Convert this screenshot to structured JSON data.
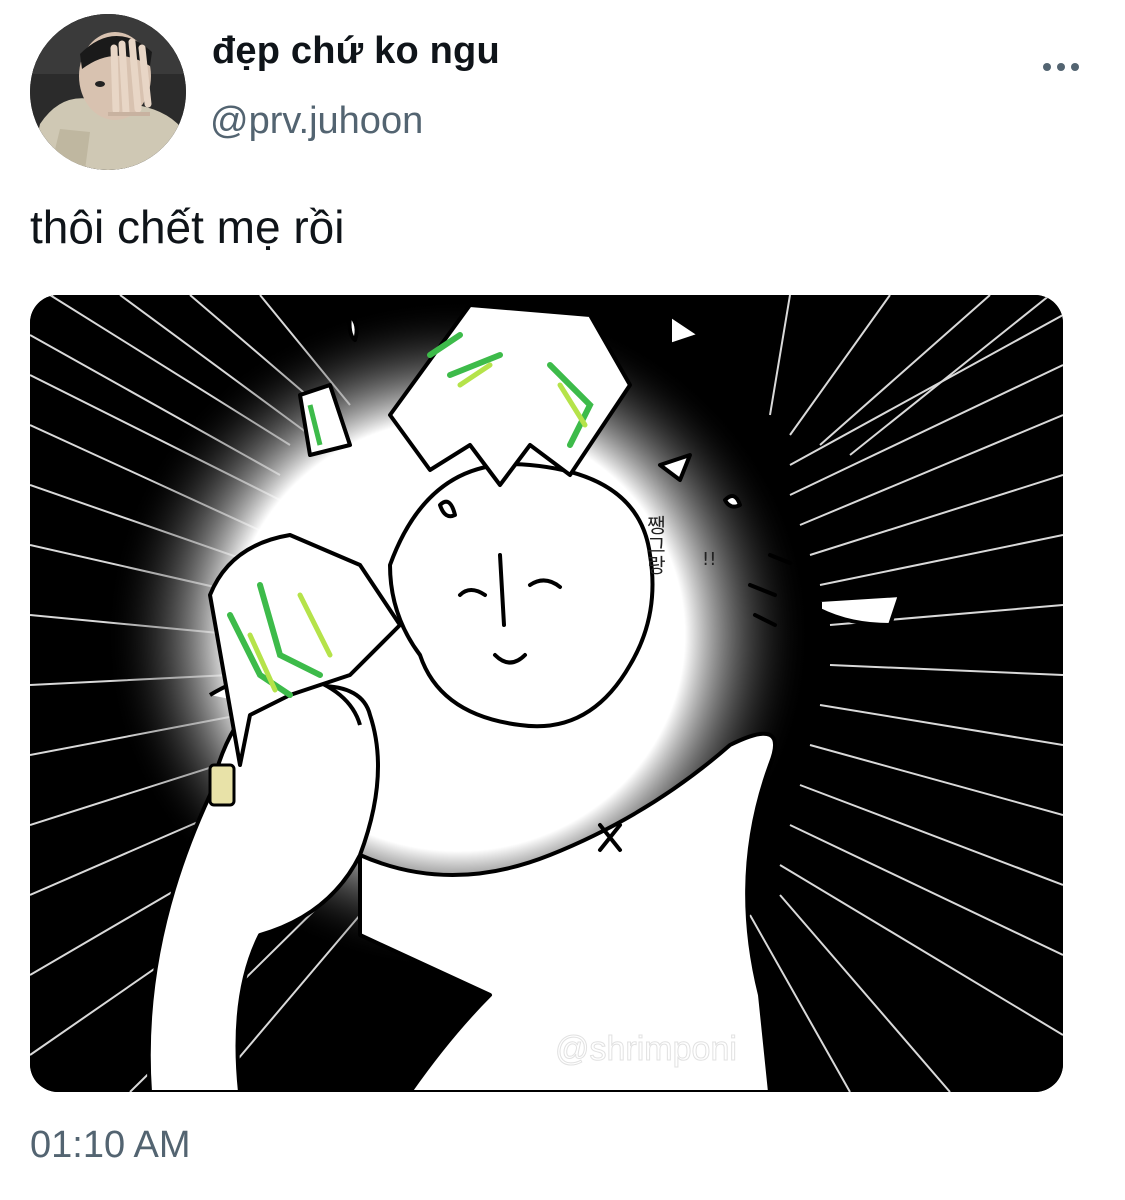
{
  "author": {
    "display_name": "đẹp chứ ko ngu",
    "handle": "@prv.juhoon"
  },
  "tweet": {
    "text": "thôi chết mẹ rồi",
    "timestamp": "01:10 AM"
  },
  "media": {
    "korean_sfx": "쨍그랑",
    "exclamation": "!!",
    "watermark": "@shrimponi"
  },
  "icons": {
    "more": "more-horizontal-icon"
  },
  "colors": {
    "text_primary": "#0f1419",
    "text_secondary": "#536471",
    "glass_green": "#3dbb4a",
    "glass_lime": "#b5e34a"
  }
}
